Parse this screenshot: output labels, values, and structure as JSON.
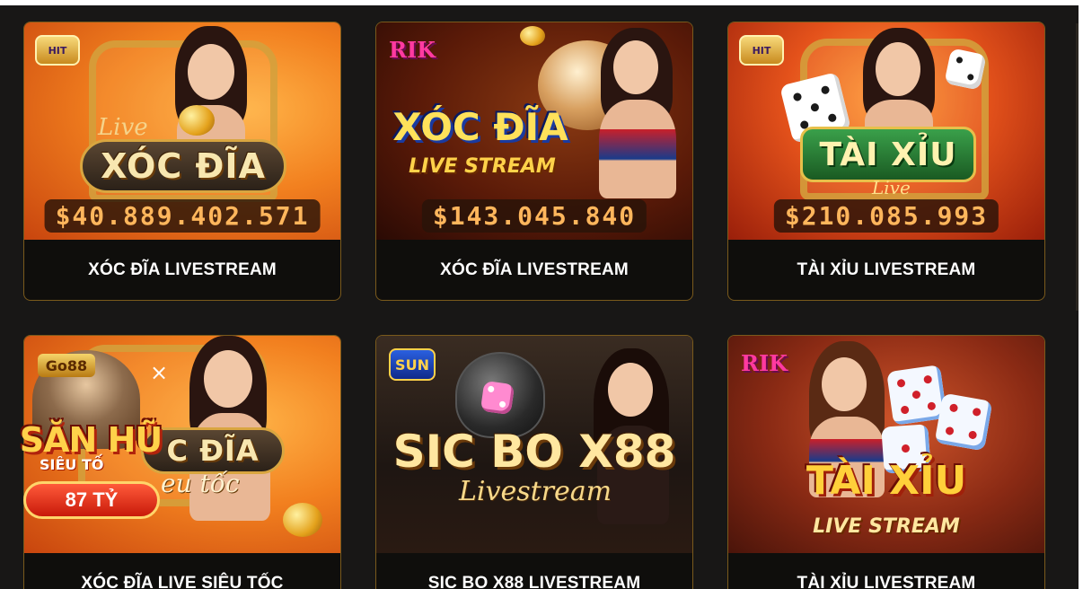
{
  "games": [
    {
      "label": "XÓC ĐĨA LIVESTREAM",
      "art_title": "XÓC ĐĨA",
      "art_script": "Live",
      "jackpot": "$40.889.402.571",
      "provider": "HIT",
      "theme": "orange"
    },
    {
      "label": "XÓC ĐĨA LIVESTREAM",
      "art_title": "XÓC ĐĨA",
      "art_subtitle": "LIVE STREAM",
      "jackpot": "$143.045.840",
      "provider": "RIK",
      "theme": "brown"
    },
    {
      "label": "TÀI XỈU LIVESTREAM",
      "art_title": "TÀI XỈU",
      "art_script": "Live",
      "jackpot": "$210.085.993",
      "provider": "HIT",
      "theme": "red"
    },
    {
      "label": "XÓC ĐĨA LIVE SIÊU TỐC",
      "art_title": "C ĐĨA",
      "art_script": "eu tốc",
      "theme": "orange"
    },
    {
      "label": "SIC BO X88 LIVESTREAM",
      "art_title": "SIC BO X88",
      "art_script": "Livestream",
      "provider": "SUN",
      "theme": "dark"
    },
    {
      "label": "TÀI XỈU LIVESTREAM",
      "art_title": "TÀI XỈU",
      "art_subtitle": "LIVE STREAM",
      "provider": "RIK",
      "theme": "rust"
    }
  ],
  "promo": {
    "badge": "Go88",
    "title": "SĂN HŨ",
    "subtitle": "SIÊU TỐ",
    "amount": "87 TỶ",
    "close_label": "×"
  },
  "colors": {
    "panel_bg": "#181716",
    "card_border": "#7a5a1c",
    "jackpot_text": "#ffb65c",
    "caption_text": "#ffffff"
  }
}
